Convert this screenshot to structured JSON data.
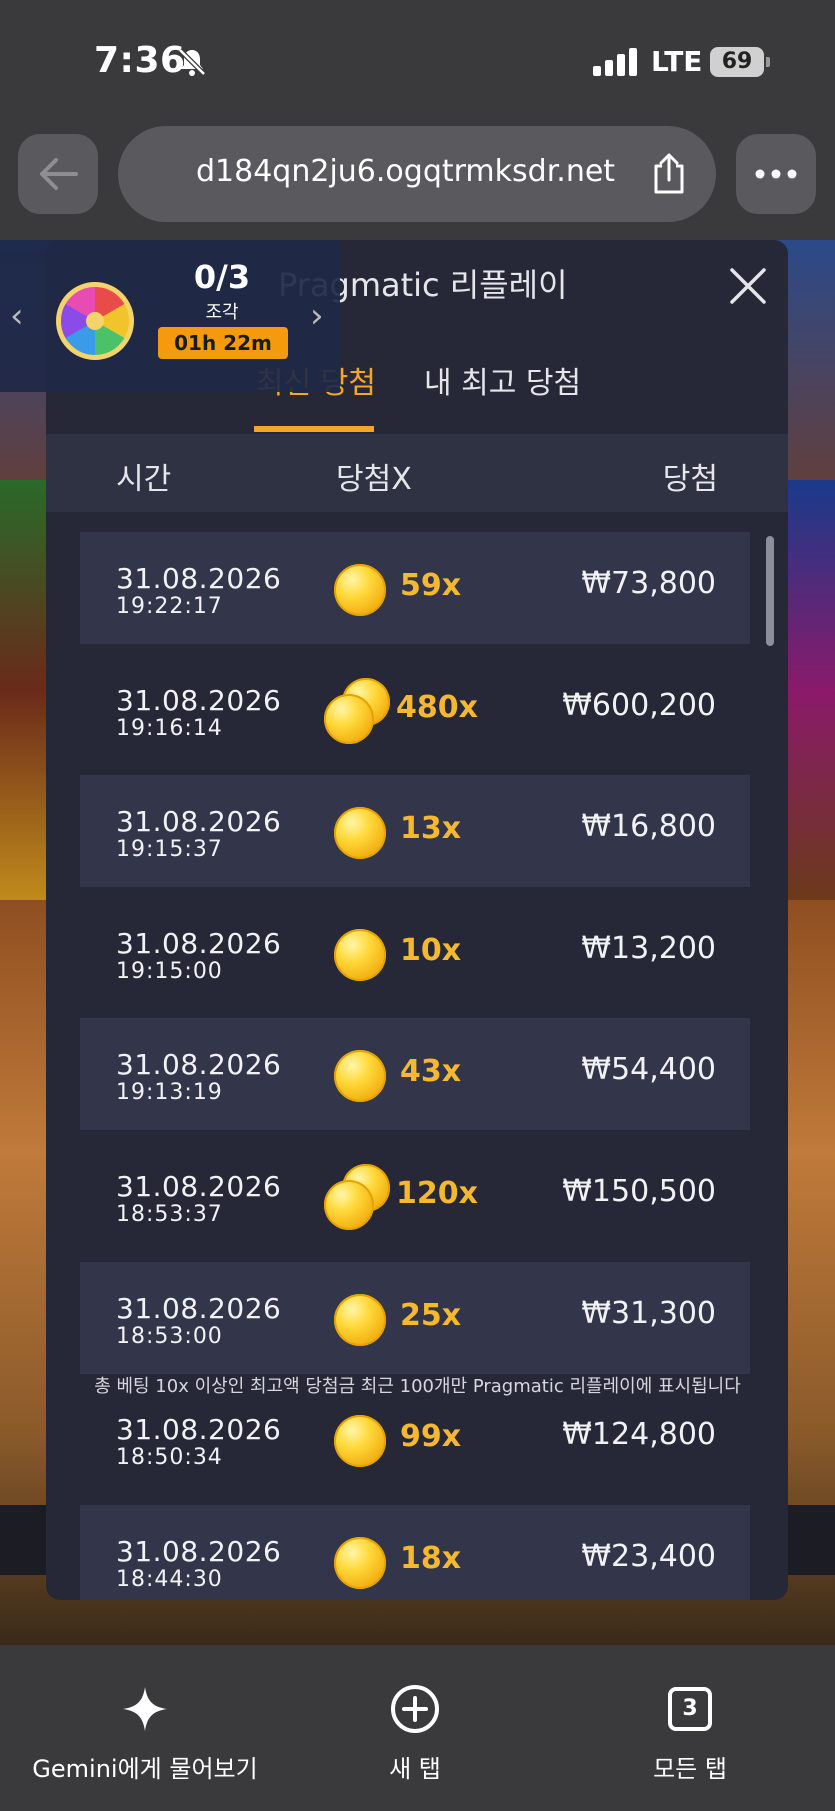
{
  "status_bar": {
    "time": "7:36",
    "network": "LTE",
    "battery": "69"
  },
  "browser": {
    "url": "d184qn2ju6.ogqtrmksdr.net"
  },
  "widget": {
    "count": "0/3",
    "label": "조각",
    "timer": "01h 22m"
  },
  "modal": {
    "title": "Pragmatic 리플레이",
    "tabs": [
      {
        "label": "최신 당첨",
        "active": true
      },
      {
        "label": "내 최고 당첨",
        "active": false
      }
    ],
    "headers": {
      "time": "시간",
      "multiplier": "당첨X",
      "win": "당첨"
    },
    "rows": [
      {
        "date": "31.08.2026",
        "time": "19:22:17",
        "multiplier": "59x",
        "win": "₩73,800",
        "coins": 1
      },
      {
        "date": "31.08.2026",
        "time": "19:16:14",
        "multiplier": "480x",
        "win": "₩600,200",
        "coins": 2
      },
      {
        "date": "31.08.2026",
        "time": "19:15:37",
        "multiplier": "13x",
        "win": "₩16,800",
        "coins": 1
      },
      {
        "date": "31.08.2026",
        "time": "19:15:00",
        "multiplier": "10x",
        "win": "₩13,200",
        "coins": 1
      },
      {
        "date": "31.08.2026",
        "time": "19:13:19",
        "multiplier": "43x",
        "win": "₩54,400",
        "coins": 1
      },
      {
        "date": "31.08.2026",
        "time": "18:53:37",
        "multiplier": "120x",
        "win": "₩150,500",
        "coins": 2
      },
      {
        "date": "31.08.2026",
        "time": "18:53:00",
        "multiplier": "25x",
        "win": "₩31,300",
        "coins": 1
      },
      {
        "date": "31.08.2026",
        "time": "18:50:34",
        "multiplier": "99x",
        "win": "₩124,800",
        "coins": 1
      },
      {
        "date": "31.08.2026",
        "time": "18:44:30",
        "multiplier": "18x",
        "win": "₩23,400",
        "coins": 1
      }
    ],
    "footnote": "총 베팅 10x 이상인 최고액 당첨금 최근 100개만 Pragmatic 리플레이에 표시됩니다"
  },
  "toolbar": {
    "gemini_label": "Gemini에게 물어보기",
    "new_tab_label": "새 탭",
    "all_tabs_label": "모든 탭",
    "tab_count": "3"
  },
  "colors": {
    "accent": "#f5a623",
    "modal_bg": "#262837",
    "row_shade": "#33364a",
    "multiplier": "#f5b82e"
  }
}
